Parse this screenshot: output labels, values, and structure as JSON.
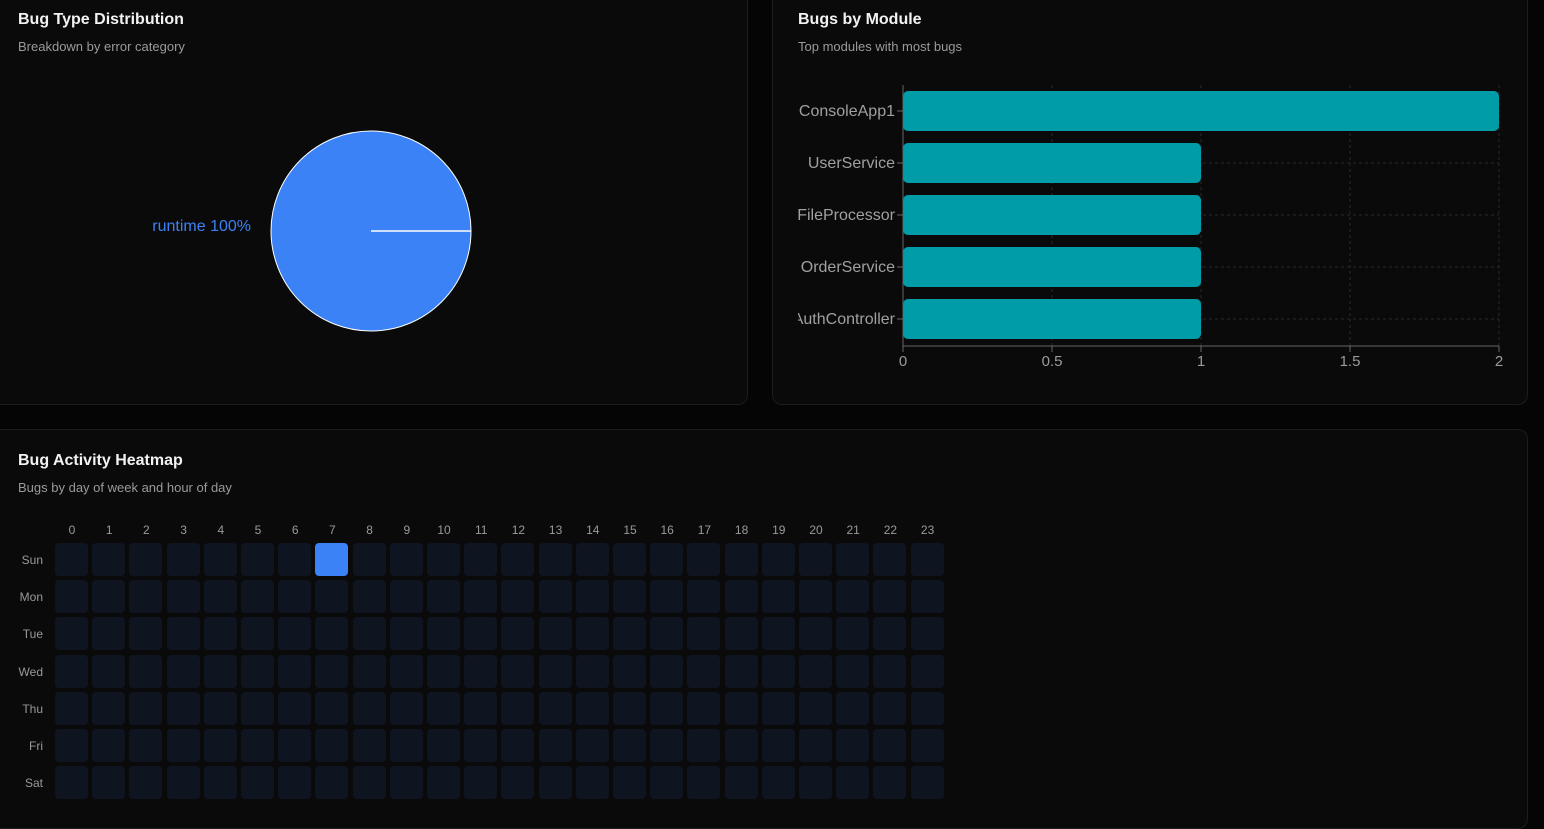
{
  "bug_type": {
    "title": "Bug Type Distribution",
    "subtitle": "Breakdown by error category"
  },
  "module": {
    "title": "Bugs by Module",
    "subtitle": "Top modules with most bugs"
  },
  "heatmap": {
    "title": "Bug Activity Heatmap",
    "subtitle": "Bugs by day of week and hour of day"
  },
  "chart_data": [
    {
      "type": "pie",
      "categories": [
        "runtime"
      ],
      "values": [
        100
      ],
      "labels": [
        "runtime 100%"
      ],
      "colors": [
        "#3b82f6"
      ]
    },
    {
      "type": "bar",
      "orientation": "horizontal",
      "categories": [
        "ConsoleApp1",
        "UserService",
        "FileProcessor",
        "OrderService",
        "AuthController"
      ],
      "values": [
        2,
        1,
        1,
        1,
        1
      ],
      "xlim": [
        0,
        2
      ],
      "xticks": [
        "0",
        "0.5",
        "1",
        "1.5",
        "2"
      ],
      "grid": true,
      "color": "#009ca8"
    },
    {
      "type": "heatmap",
      "x": [
        "0",
        "1",
        "2",
        "3",
        "4",
        "5",
        "6",
        "7",
        "8",
        "9",
        "10",
        "11",
        "12",
        "13",
        "14",
        "15",
        "16",
        "17",
        "18",
        "19",
        "20",
        "21",
        "22",
        "23"
      ],
      "y": [
        "Sun",
        "Mon",
        "Tue",
        "Wed",
        "Thu",
        "Fri",
        "Sat"
      ],
      "values": [
        [
          0,
          0,
          0,
          0,
          0,
          0,
          0,
          1,
          0,
          0,
          0,
          0,
          0,
          0,
          0,
          0,
          0,
          0,
          0,
          0,
          0,
          0,
          0,
          0
        ],
        [
          0,
          0,
          0,
          0,
          0,
          0,
          0,
          0,
          0,
          0,
          0,
          0,
          0,
          0,
          0,
          0,
          0,
          0,
          0,
          0,
          0,
          0,
          0,
          0
        ],
        [
          0,
          0,
          0,
          0,
          0,
          0,
          0,
          0,
          0,
          0,
          0,
          0,
          0,
          0,
          0,
          0,
          0,
          0,
          0,
          0,
          0,
          0,
          0,
          0
        ],
        [
          0,
          0,
          0,
          0,
          0,
          0,
          0,
          0,
          0,
          0,
          0,
          0,
          0,
          0,
          0,
          0,
          0,
          0,
          0,
          0,
          0,
          0,
          0,
          0
        ],
        [
          0,
          0,
          0,
          0,
          0,
          0,
          0,
          0,
          0,
          0,
          0,
          0,
          0,
          0,
          0,
          0,
          0,
          0,
          0,
          0,
          0,
          0,
          0,
          0
        ],
        [
          0,
          0,
          0,
          0,
          0,
          0,
          0,
          0,
          0,
          0,
          0,
          0,
          0,
          0,
          0,
          0,
          0,
          0,
          0,
          0,
          0,
          0,
          0,
          0
        ],
        [
          0,
          0,
          0,
          0,
          0,
          0,
          0,
          0,
          0,
          0,
          0,
          0,
          0,
          0,
          0,
          0,
          0,
          0,
          0,
          0,
          0,
          0,
          0,
          0
        ]
      ],
      "colors": {
        "empty": "#0f1421",
        "active": "#3b82f6"
      }
    }
  ]
}
